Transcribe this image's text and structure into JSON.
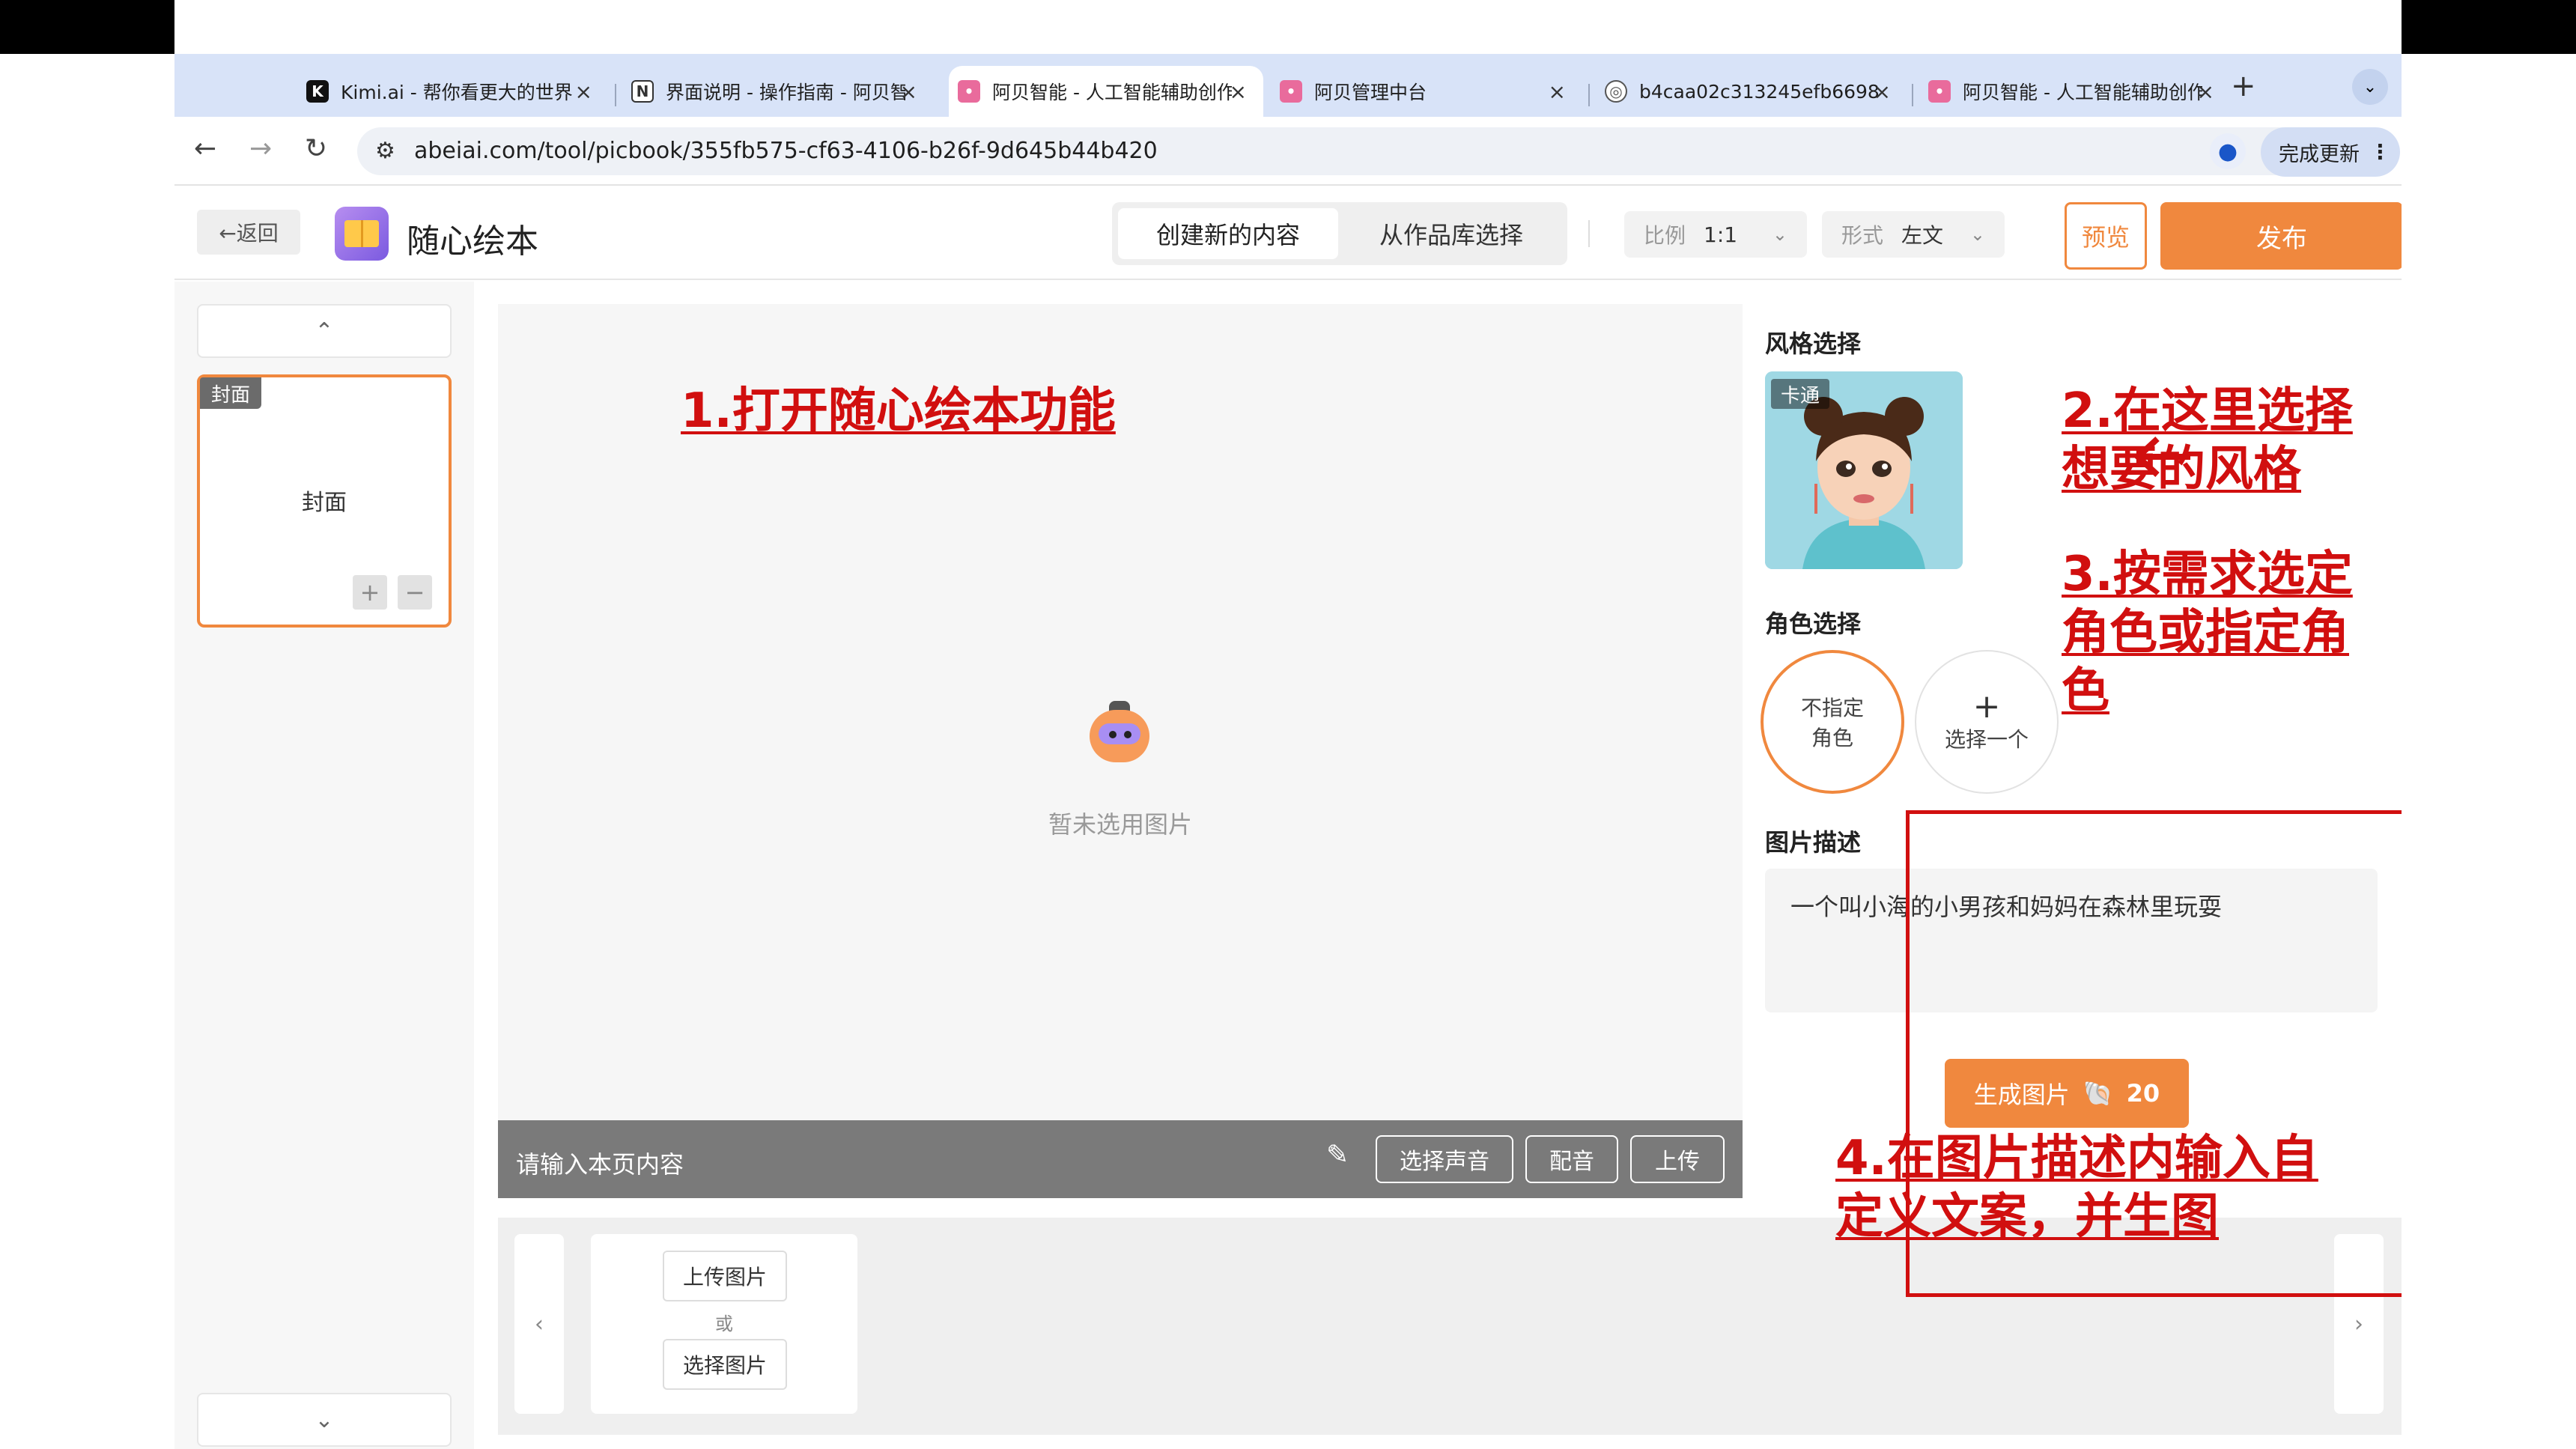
{
  "browser": {
    "tabs": [
      {
        "title": "Kimi.ai - 帮你看更大的世界",
        "favicon": "kimi-icon",
        "fav_color": "#111111",
        "active": false
      },
      {
        "title": "界面说明 - 操作指南 - 阿贝智能",
        "favicon": "doc-icon",
        "fav_color": "#333333",
        "active": false
      },
      {
        "title": "阿贝智能 - 人工智能辅助创作",
        "favicon": "abei-icon",
        "fav_color": "#e96b9c",
        "active": true
      },
      {
        "title": "阿贝管理中台",
        "favicon": "abei-icon",
        "fav_color": "#e96b9c",
        "active": false
      },
      {
        "title": "b4caa02c313245efb6698",
        "favicon": "globe-icon",
        "fav_color": "#555555",
        "active": false
      },
      {
        "title": "阿贝智能 - 人工智能辅助创作",
        "favicon": "abei-icon",
        "fav_color": "#e96b9c",
        "active": false
      }
    ],
    "new_tab": "+",
    "url": "abeiai.com/tool/picbook/355fb575-cf63-4106-b26f-9d645b44b420",
    "update_label": "完成更新"
  },
  "header": {
    "back_label": "←返回",
    "app_title": "随心绘本",
    "segments": [
      "创建新的内容",
      "从作品库选择"
    ],
    "ratio": {
      "label": "比例",
      "value": "1:1"
    },
    "format": {
      "label": "形式",
      "value": "左文"
    },
    "preview_label": "预览",
    "publish_label": "发布"
  },
  "pages": {
    "cover_badge": "封面",
    "cover_name": "封面",
    "add": "+",
    "remove": "−"
  },
  "canvas": {
    "empty_text": "暂未选用图片",
    "text_placeholder": "请输入本页内容",
    "buttons": [
      "选择声音",
      "配音",
      "上传"
    ]
  },
  "filmstrip": {
    "upload_label": "上传图片",
    "or_label": "或",
    "select_label": "选择图片"
  },
  "right": {
    "style_title": "风格选择",
    "style_tag": "卡通",
    "role_title": "角色选择",
    "role_none_line1": "不指定",
    "role_none_line2": "角色",
    "role_add": "选择一个",
    "desc_title": "图片描述",
    "desc_value": "一个叫小海的小男孩和妈妈在森林里玩耍",
    "generate_label": "生成图片",
    "generate_cost": "20"
  },
  "annotations": {
    "a1": "1.打开随心绘本功能",
    "a2_line1": "2.在这里选择",
    "a2_line2": "想要的风格",
    "a3_line1": "3.按需求选定",
    "a3_line2": "角色或指定角",
    "a3_line3": "色",
    "a4_line1": "4.在图片描述内输入自",
    "a4_line2": "定义文案，并生图"
  },
  "colors": {
    "accent": "#f0883e",
    "annotation": "#d10f0f"
  }
}
